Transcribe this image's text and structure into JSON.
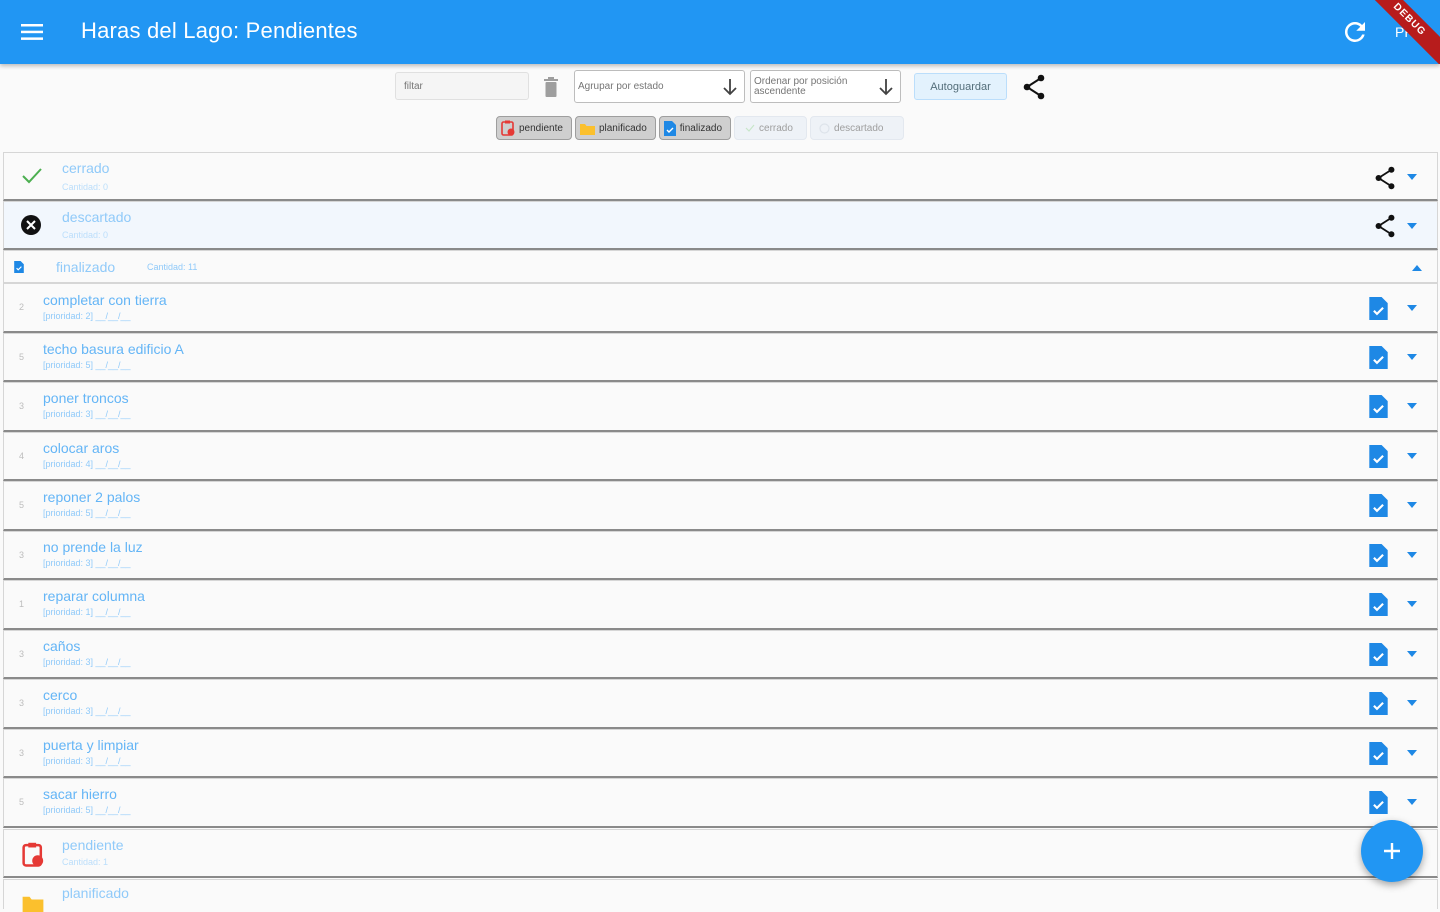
{
  "appbar": {
    "title": "Haras del Lago: Pendientes",
    "user_initials": "PP",
    "debug_banner": "DEBUG"
  },
  "toolbar": {
    "filter_placeholder": "filtar",
    "group_by": "Agrupar por estado",
    "sort_by": "Ordenar por posición ascendente",
    "autosave_label": "Autoguardar"
  },
  "chips": [
    {
      "label": "pendiente",
      "selected": true,
      "icon": "clipboard-clock-icon"
    },
    {
      "label": "planificado",
      "selected": true,
      "icon": "folder-icon"
    },
    {
      "label": "finalizado",
      "selected": true,
      "icon": "document-icon"
    },
    {
      "label": "cerrado",
      "selected": false,
      "icon": "check-icon"
    },
    {
      "label": "descartado",
      "selected": false,
      "icon": "circle-icon"
    }
  ],
  "groups": {
    "cerrado": {
      "label": "cerrado",
      "count": "Cantidad: 0"
    },
    "descartado": {
      "label": "descartado",
      "count": "Cantidad: 0"
    },
    "finalizado": {
      "label": "finalizado",
      "count": "Cantidad: 11"
    },
    "pendiente": {
      "label": "pendiente",
      "count": "Cantidad: 1"
    },
    "planificado": {
      "label": "planificado"
    }
  },
  "tasks": [
    {
      "num": "2",
      "title": "completar con tierra",
      "sub": "[prioridad: 2] __/__/__"
    },
    {
      "num": "5",
      "title": "techo basura edificio A",
      "sub": "[prioridad: 5] __/__/__"
    },
    {
      "num": "3",
      "title": "poner troncos",
      "sub": "[prioridad: 3] __/__/__"
    },
    {
      "num": "4",
      "title": "colocar aros",
      "sub": "[prioridad: 4] __/__/__"
    },
    {
      "num": "5",
      "title": "reponer 2 palos",
      "sub": "[prioridad: 5] __/__/__"
    },
    {
      "num": "3",
      "title": "no prende la luz",
      "sub": "[prioridad: 3] __/__/__"
    },
    {
      "num": "1",
      "title": "reparar columna",
      "sub": "[prioridad: 1] __/__/__"
    },
    {
      "num": "3",
      "title": "caños",
      "sub": "[prioridad: 3] __/__/__"
    },
    {
      "num": "3",
      "title": "cerco",
      "sub": "[prioridad: 3] __/__/__"
    },
    {
      "num": "3",
      "title": "puerta y limpiar",
      "sub": "[prioridad: 3] __/__/__"
    },
    {
      "num": "5",
      "title": "sacar hierro",
      "sub": "[prioridad: 5] __/__/__"
    }
  ],
  "colors": {
    "primary": "#2196f3",
    "check": "#4caf50",
    "pending": "#e53935",
    "planned": "#fbc02d"
  }
}
